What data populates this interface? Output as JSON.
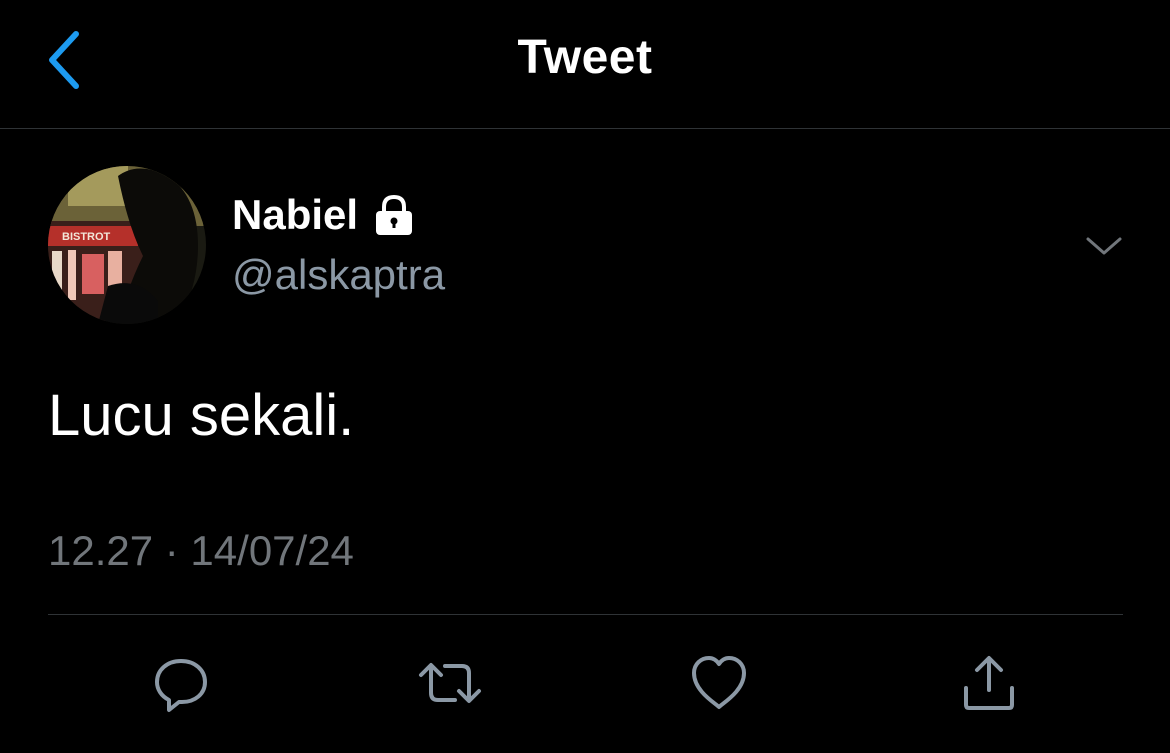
{
  "header": {
    "title": "Tweet"
  },
  "author": {
    "display_name": "Nabiel",
    "handle": "@alskaptra",
    "avatar_sign_text": "BISTROT",
    "protected_icon": "lock-icon"
  },
  "tweet": {
    "text": "Lucu sekali.",
    "timestamp": "12.27 · 14/07/24"
  },
  "actions": {
    "icons": [
      "reply-icon",
      "retweet-icon",
      "like-icon",
      "share-icon"
    ]
  },
  "colors": {
    "background": "#000000",
    "accent": "#1d9bf0",
    "secondary_text": "#71767b",
    "divider": "#2f3336"
  }
}
